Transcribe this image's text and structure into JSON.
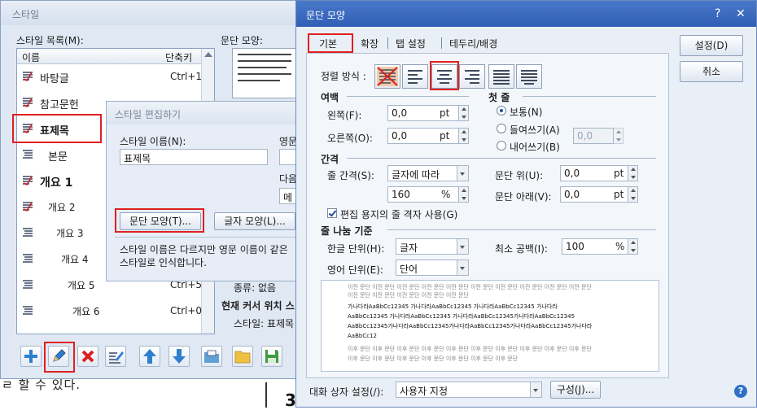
{
  "background_doc": {
    "text": "ㄹ 할 수 있다.",
    "number": "3"
  },
  "style_dialog": {
    "title": "스타일",
    "list_label": "스타일 목록(M):",
    "preview_label": "문단 모양:",
    "col_name": "이름",
    "col_key": "단축키",
    "items": [
      {
        "name": "바탕글",
        "key": "Ctrl+1"
      },
      {
        "name": "참고문헌",
        "key": ""
      },
      {
        "name": "표제목",
        "key": ""
      },
      {
        "name": "본문",
        "key": ""
      },
      {
        "name": "개요 1",
        "key": ""
      },
      {
        "name": "개요 2",
        "key": ""
      },
      {
        "name": "개요 3",
        "key": ""
      },
      {
        "name": "개요 4",
        "key": ""
      },
      {
        "name": "개요 5",
        "key": "Ctrl+5"
      },
      {
        "name": "개요 6",
        "key": "Ctrl+0"
      }
    ],
    "info_line1": "종류: 없음",
    "info_line2": "현재 커서 위치 스",
    "info_line3": "스타일: 표제목"
  },
  "edit_dialog": {
    "title": "스타일 편집하기",
    "name_label": "스타일 이름(N):",
    "name_value": "표제목",
    "eng_label": "영문",
    "next_label": "다음",
    "next_value": "메모",
    "para_button": "문단 모양(T)...",
    "char_button": "글자 모양(L)...",
    "note": "스타일 이름은 다르지만 영문 이름이 같은 스타일로 인식합니다.",
    "note_line1": "스타일 이름은 다르지만 영문 이름이 같은",
    "note_line2": "스타일로 인식합니다."
  },
  "para_dialog": {
    "title": "문단 모양",
    "help": "?",
    "close": "✕",
    "tabs": [
      "기본",
      "확장",
      "탭 설정",
      "테두리/배경"
    ],
    "ok": "설정(D)",
    "cancel": "취소",
    "align_label": "정렬 방식 :",
    "margin_title": "여백",
    "left_label": "왼쪽(F):",
    "left_value": "0,0",
    "right_label": "오른쪽(O):",
    "right_value": "0,0",
    "unit_pt": "pt",
    "first_title": "첫 줄",
    "first_normal": "보통(N)",
    "first_indent": "들여쓰기(A)",
    "first_outdent": "내어쓰기(B)",
    "first_value": "0,0",
    "spacing_title": "간격",
    "line_label": "줄 간격(S):",
    "line_type": "글자에 따라",
    "line_value": "160",
    "unit_pct": "%",
    "above_label": "문단 위(U):",
    "above_value": "0,0",
    "below_label": "문단 아래(V):",
    "below_value": "0,0",
    "grid_label": "편집 용지의 줄 격자 사용(G)",
    "break_title": "줄 나눔 기준",
    "kor_label": "한글 단위(H):",
    "kor_value": "글자",
    "eng_label": "영어 단위(E):",
    "eng_value": "단어",
    "min_label": "최소 공백(I):",
    "min_value": "100",
    "preset_label": "대화 상자 설정(/):",
    "preset_value": "사용자 지정",
    "config_button": "구성(J)...",
    "help_icon": "?",
    "sample_prev": "이전 문단 이전 문단 이전 문단 이전 문단 이전 문단 이전 문단 이전 문단 이전 문단 이전 문단 이전 문단",
    "sample_prev2": "이전 문단 이전 문단 이전 문단 이전 문단 이전 문단",
    "sample_main1": "가나다라AaBbCc12345    가나다라AaBbCc12345    가나다라AaBbCc12345    가나다라",
    "sample_main2": "AaBbCc12345    가나다라AaBbCc12345  가나다라AaBbCc12345가나다라AaBbCc12345",
    "sample_main3": "AaBbCc12345가나다라AaBbCc12345가나다라AaBbCc12345가나다라AaBbCc12345가나다라",
    "sample_main4": "AaBbCc12",
    "sample_next": "이후 문단 이후 문단 이후 문단 이후 문단 이후 문단 이후 문단 이후 문단 이후 문단 이후 문단 이후 문단",
    "sample_next2": "이후 문단 이후 문단 이후 문단 이후 문단 이후 문단 이후 문단 이후 문단"
  },
  "colors": {
    "accent_red": "#e02020",
    "title_blue": "#2f5fb6"
  }
}
